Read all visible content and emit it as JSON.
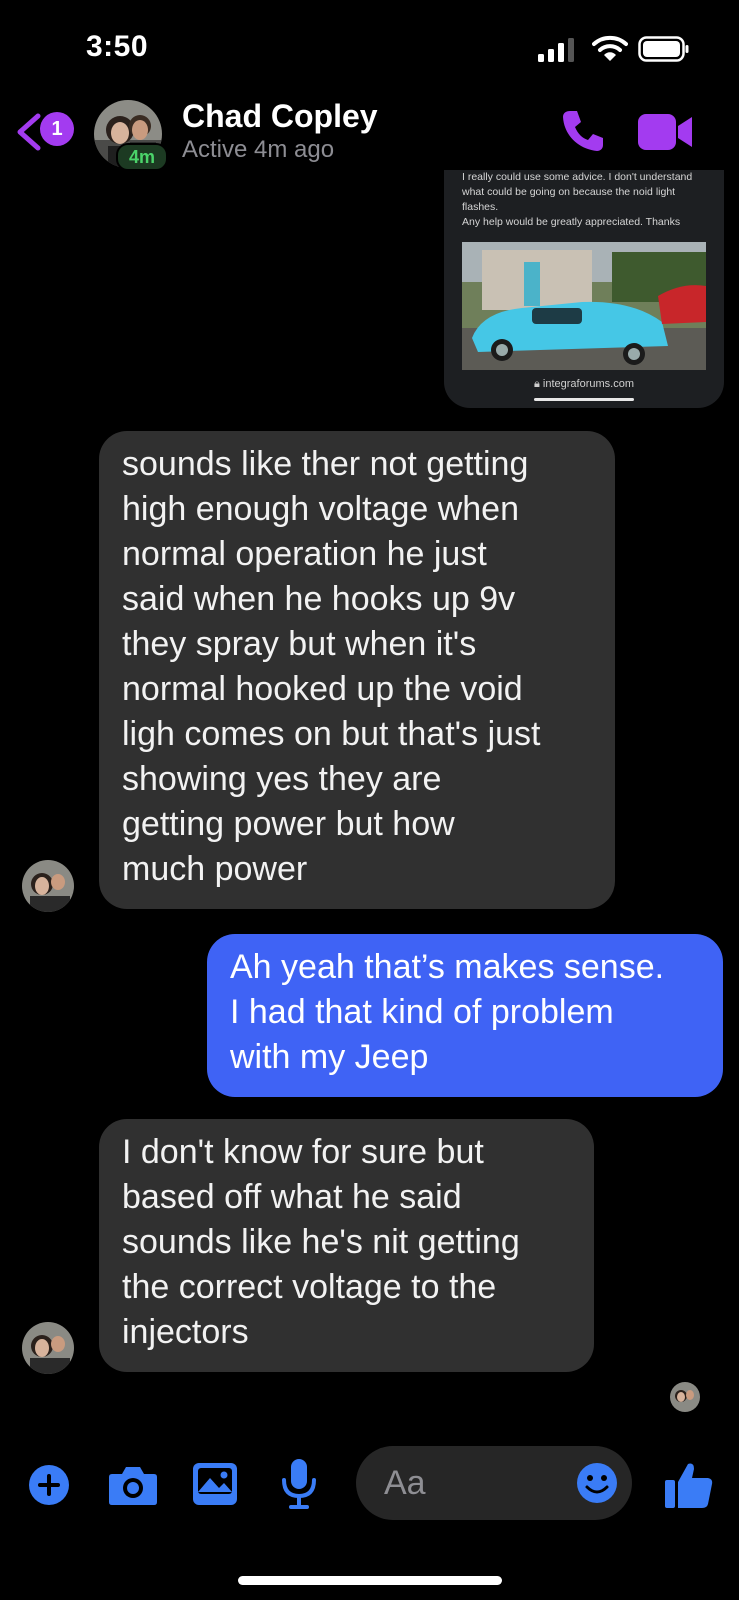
{
  "status_bar": {
    "time": "3:50"
  },
  "header": {
    "unread_count": "1",
    "contact_name": "Chad Copley",
    "active_badge": "4m",
    "contact_status": "Active 4m ago",
    "accent_color": "#a33bf0"
  },
  "shared_card": {
    "text_lines": [
      "I really could use some advice. I don't understand",
      "what could be going on because the noid light",
      "flashes.",
      "Any help would be greatly appreciated. Thanks"
    ],
    "url": "integraforums.com"
  },
  "messages": [
    {
      "direction": "incoming",
      "lines": [
        "sounds like ther not getting",
        "high enough voltage when",
        "normal operation he just",
        "said when he hooks up 9v",
        "they spray but when it's",
        "normal hooked up the void",
        "ligh comes on but that's just",
        "showing yes they are",
        "getting power but how",
        "much power"
      ]
    },
    {
      "direction": "outgoing",
      "lines": [
        "Ah yeah that’s makes sense.",
        "I had that kind of problem",
        "with my Jeep"
      ]
    },
    {
      "direction": "incoming",
      "lines": [
        "I don't know for sure but",
        "based off what he said",
        "sounds like he's nit getting",
        "the correct voltage to the",
        "injectors"
      ]
    }
  ],
  "composer": {
    "placeholder": "Aa",
    "icons": [
      "plus-icon",
      "camera-icon",
      "gallery-icon",
      "microphone-icon",
      "emoji-icon",
      "thumbs-up-icon"
    ],
    "icon_color": "#3a7cf6"
  }
}
